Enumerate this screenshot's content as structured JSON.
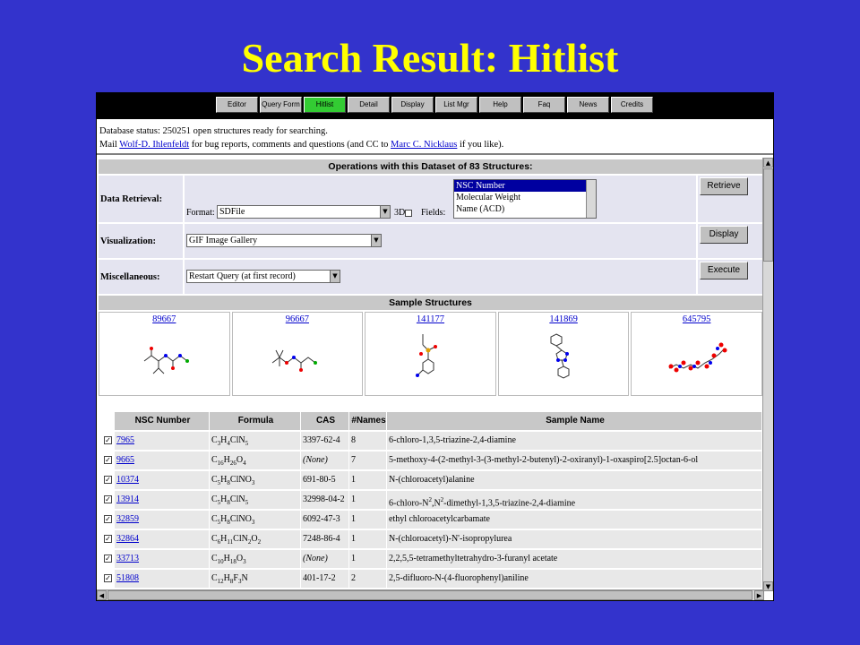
{
  "slide": {
    "title": "Search Result: Hitlist"
  },
  "nav": {
    "buttons": [
      "Editor",
      "Query Form",
      "Hitlist",
      "Detail",
      "Display",
      "List Mgr",
      "Help",
      "Faq",
      "News",
      "Credits"
    ],
    "active": "Hitlist"
  },
  "status": {
    "line1": "Database status: 250251 open structures ready for searching.",
    "mail_prefix": "Mail ",
    "contact1": "Wolf-D. Ihlenfeldt",
    "middle": " for bug reports, comments and questions (and CC to ",
    "contact2": "Marc C. Nicklaus",
    "suffix": " if you like)."
  },
  "operations": {
    "header": "Operations with this Dataset of 83 Structures:",
    "data_retrieval": {
      "label": "Data Retrieval:",
      "format_label": "Format:",
      "format_value": "SDFile",
      "threed_label": "3D",
      "fields_label": "Fields:",
      "fields_options": [
        "NSC Number",
        "Molecular Weight",
        "Name (ACD)"
      ],
      "fields_selected": "NSC Number",
      "button": "Retrieve"
    },
    "visualization": {
      "label": "Visualization:",
      "value": "GIF Image Gallery",
      "button": "Display"
    },
    "miscellaneous": {
      "label": "Miscellaneous:",
      "value": "Restart Query (at first record)",
      "button": "Execute"
    }
  },
  "samples": {
    "header": "Sample Structures",
    "items": [
      {
        "id": "89667"
      },
      {
        "id": "96667"
      },
      {
        "id": "141177"
      },
      {
        "id": "141869"
      },
      {
        "id": "645795"
      }
    ]
  },
  "hitlist": {
    "columns": [
      "NSC Number",
      "Formula",
      "CAS",
      "#Names",
      "Sample Name"
    ],
    "rows": [
      {
        "checked": true,
        "nsc": "7965",
        "formula": [
          [
            "C",
            ""
          ],
          [
            "3",
            "sub"
          ],
          [
            "H",
            ""
          ],
          [
            "4",
            "sub"
          ],
          [
            "ClN",
            ""
          ],
          [
            "5",
            "sub"
          ]
        ],
        "cas": "3397-62-4",
        "names": "8",
        "name": [
          [
            "6-chloro-1,3,5-triazine-2,4-diamine",
            ""
          ]
        ]
      },
      {
        "checked": true,
        "nsc": "9665",
        "formula": [
          [
            "C",
            ""
          ],
          [
            "16",
            "sub"
          ],
          [
            "H",
            ""
          ],
          [
            "26",
            "sub"
          ],
          [
            "O",
            ""
          ],
          [
            "4",
            "sub"
          ]
        ],
        "cas": "(None)",
        "names": "7",
        "name": [
          [
            "5-methoxy-4-(2-methyl-3-(3-methyl-2-butenyl)-2-oxiranyl)-1-oxaspiro[2.5]octan-6-ol",
            ""
          ]
        ]
      },
      {
        "checked": true,
        "nsc": "10374",
        "formula": [
          [
            "C",
            ""
          ],
          [
            "5",
            "sub"
          ],
          [
            "H",
            ""
          ],
          [
            "8",
            "sub"
          ],
          [
            "ClNO",
            ""
          ],
          [
            "3",
            "sub"
          ]
        ],
        "cas": "691-80-5",
        "names": "1",
        "name": [
          [
            "N-(chloroacetyl)alanine",
            ""
          ]
        ]
      },
      {
        "checked": true,
        "nsc": "13914",
        "formula": [
          [
            "C",
            ""
          ],
          [
            "5",
            "sub"
          ],
          [
            "H",
            ""
          ],
          [
            "8",
            "sub"
          ],
          [
            "ClN",
            ""
          ],
          [
            "5",
            "sub"
          ]
        ],
        "cas": "32998-04-2",
        "names": "1",
        "name": [
          [
            "6-chloro-N",
            ""
          ],
          [
            "2",
            "sup"
          ],
          [
            ",N",
            ""
          ],
          [
            "2",
            "sup"
          ],
          [
            "-dimethyl-1,3,5-triazine-2,4-diamine",
            ""
          ]
        ]
      },
      {
        "checked": true,
        "nsc": "32859",
        "formula": [
          [
            "C",
            ""
          ],
          [
            "5",
            "sub"
          ],
          [
            "H",
            ""
          ],
          [
            "8",
            "sub"
          ],
          [
            "ClNO",
            ""
          ],
          [
            "3",
            "sub"
          ]
        ],
        "cas": "6092-47-3",
        "names": "1",
        "name": [
          [
            "ethyl chloroacetylcarbamate",
            ""
          ]
        ]
      },
      {
        "checked": true,
        "nsc": "32864",
        "formula": [
          [
            "C",
            ""
          ],
          [
            "6",
            "sub"
          ],
          [
            "H",
            ""
          ],
          [
            "11",
            "sub"
          ],
          [
            "ClN",
            ""
          ],
          [
            "2",
            "sub"
          ],
          [
            "O",
            ""
          ],
          [
            "2",
            "sub"
          ]
        ],
        "cas": "7248-86-4",
        "names": "1",
        "name": [
          [
            "N-(chloroacetyl)-N'-isopropylurea",
            ""
          ]
        ]
      },
      {
        "checked": true,
        "nsc": "33713",
        "formula": [
          [
            "C",
            ""
          ],
          [
            "10",
            "sub"
          ],
          [
            "H",
            ""
          ],
          [
            "18",
            "sub"
          ],
          [
            "O",
            ""
          ],
          [
            "3",
            "sub"
          ]
        ],
        "cas": "(None)",
        "names": "1",
        "name": [
          [
            "2,2,5,5-tetramethyltetrahydro-3-furanyl acetate",
            ""
          ]
        ]
      },
      {
        "checked": true,
        "nsc": "51808",
        "formula": [
          [
            "C",
            ""
          ],
          [
            "12",
            "sub"
          ],
          [
            "H",
            ""
          ],
          [
            "8",
            "sub"
          ],
          [
            "F",
            ""
          ],
          [
            "3",
            "sub"
          ],
          [
            "N",
            ""
          ]
        ],
        "cas": "401-17-2",
        "names": "2",
        "name": [
          [
            "2,5-difluoro-N-(4-fluorophenyl)aniline",
            ""
          ]
        ]
      }
    ]
  },
  "colors": {
    "background": "#3333cc",
    "title": "#ffff00",
    "active_tab": "#33cc33",
    "link": "#0000cc"
  }
}
